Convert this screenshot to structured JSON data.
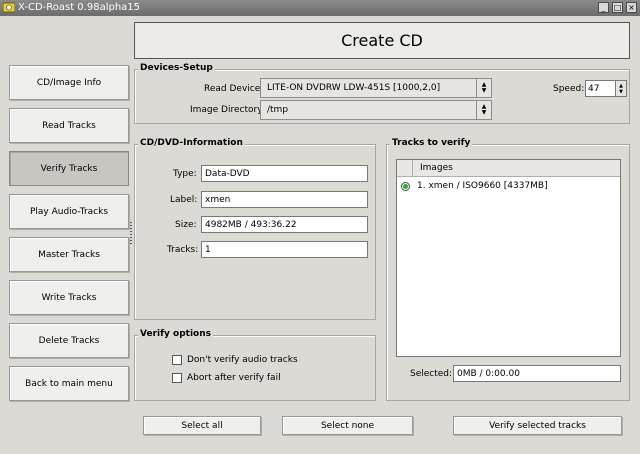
{
  "window": {
    "title": "X-CD-Roast 0.98alpha15",
    "buttons": [
      "_",
      "□",
      "×"
    ]
  },
  "header": {
    "title": "Create CD"
  },
  "sidebar": {
    "items": [
      {
        "label": "CD/Image Info"
      },
      {
        "label": "Read Tracks"
      },
      {
        "label": "Verify Tracks"
      },
      {
        "label": "Play Audio-Tracks"
      },
      {
        "label": "Master Tracks"
      },
      {
        "label": "Write Tracks"
      },
      {
        "label": "Delete Tracks"
      },
      {
        "label": "Back to main menu"
      }
    ]
  },
  "devices": {
    "title": "Devices-Setup",
    "read_device_label": "Read Device:",
    "read_device_value": "LITE-ON  DVDRW LDW-451S  [1000,2,0]",
    "image_dir_label": "Image Directory:",
    "image_dir_value": "/tmp",
    "speed_label": "Speed:",
    "speed_value": "47"
  },
  "info": {
    "title": "CD/DVD-Information",
    "type_label": "Type:",
    "type_value": "Data-DVD",
    "label_label": "Label:",
    "label_value": "xmen",
    "size_label": "Size:",
    "size_value": "4982MB / 493:36.22",
    "tracks_label": "Tracks:",
    "tracks_value": "1"
  },
  "verify": {
    "title": "Verify options",
    "opt1": "Don't verify audio tracks",
    "opt2": "Abort after verify fail"
  },
  "tracks": {
    "title": "Tracks to verify",
    "column": "Images",
    "rows": [
      {
        "label": "1. xmen / ISO9660 [4337MB]"
      }
    ],
    "selected_label": "Selected:",
    "selected_value": "0MB / 0:00.00"
  },
  "actions": {
    "select_all": "Select all",
    "select_none": "Select none",
    "verify_selected": "Verify selected tracks"
  }
}
